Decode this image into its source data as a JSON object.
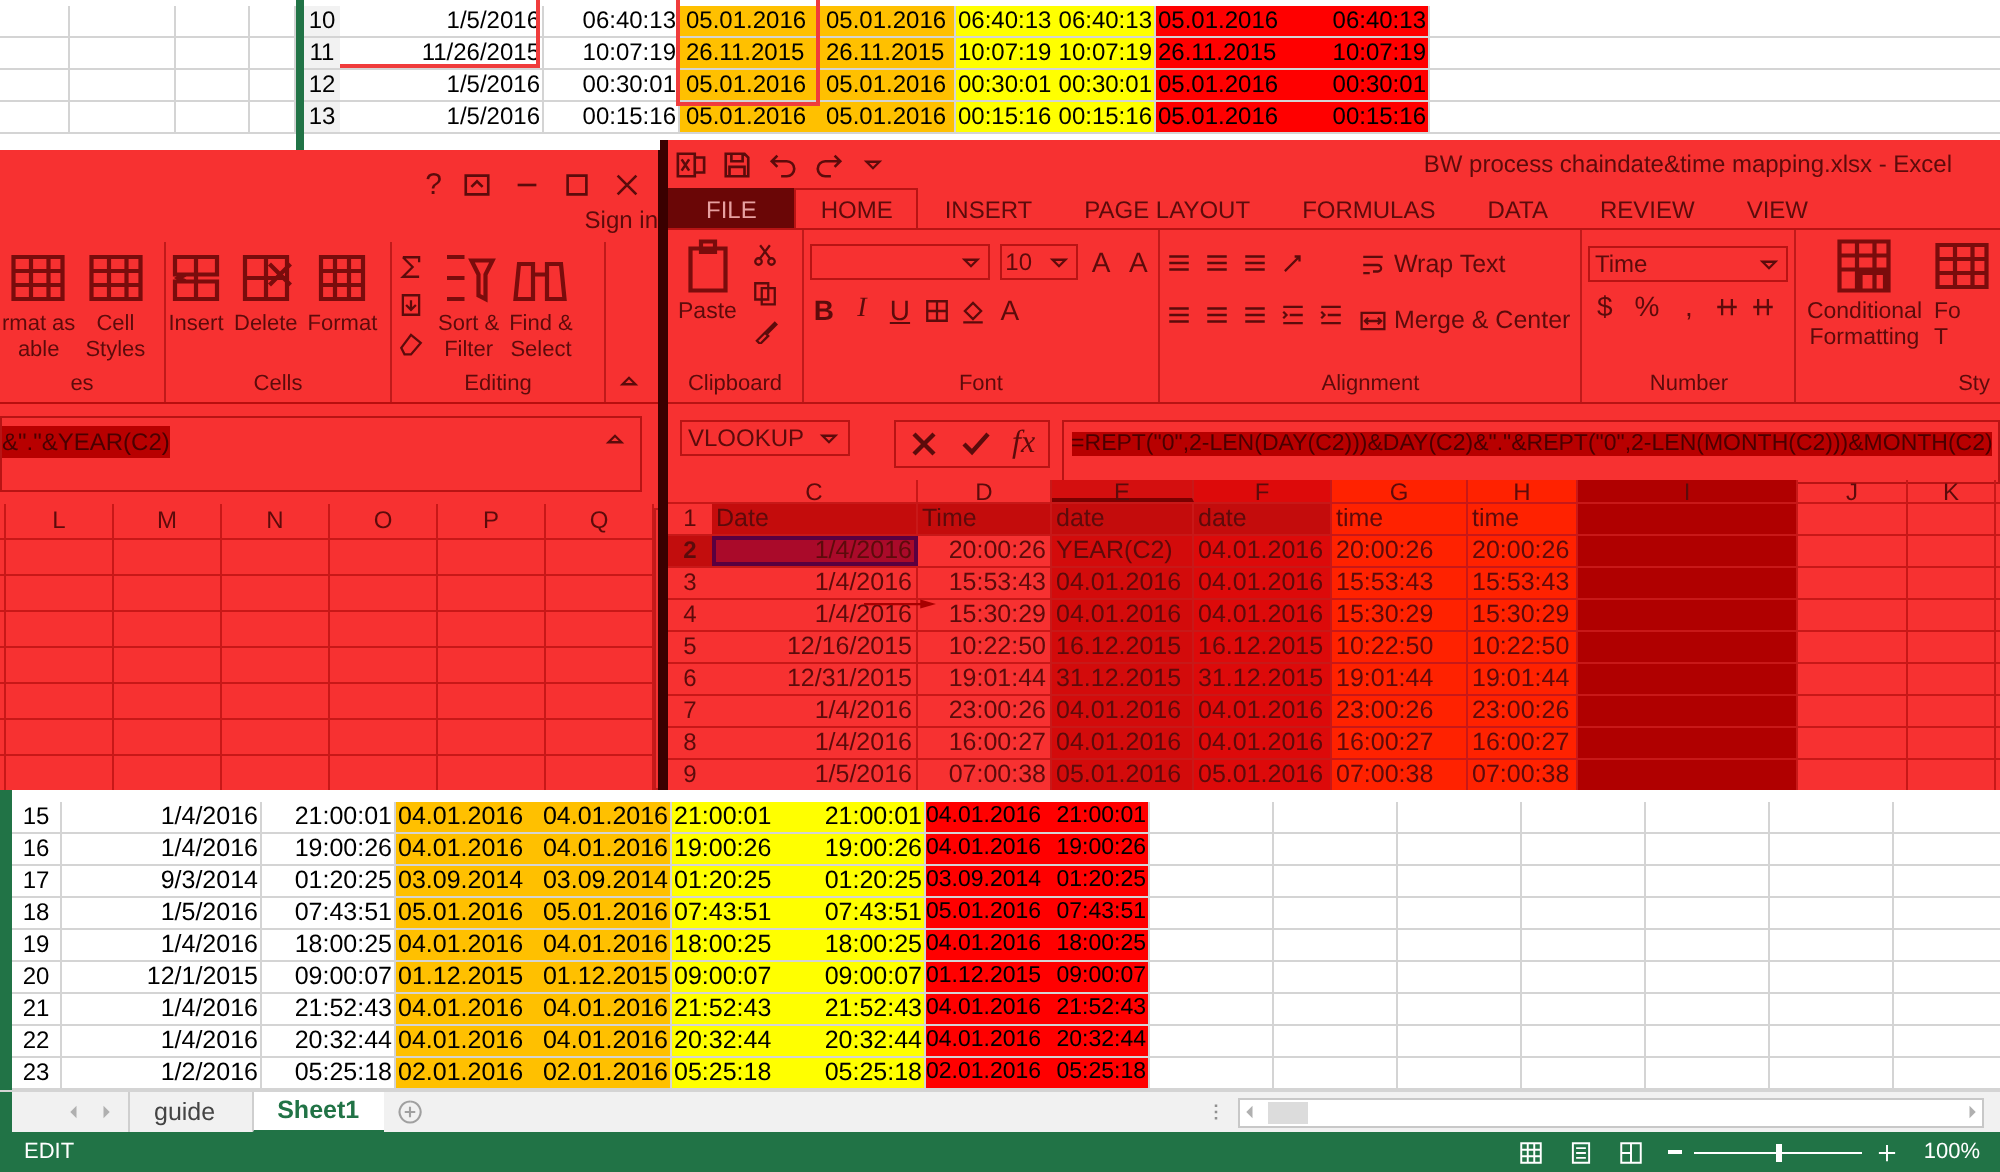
{
  "top_sheet": {
    "rows": [
      {
        "header": "10",
        "cells": [
          "1/5/2016",
          "06:40:13",
          "05.01.2016",
          "05.01.2016",
          "06:40:13",
          "06:40:13",
          "05.01.2016",
          "06:40:13"
        ]
      },
      {
        "header": "11",
        "cells": [
          "11/26/2015",
          "10:07:19",
          "26.11.2015",
          "26.11.2015",
          "10:07:19",
          "10:07:19",
          "26.11.2015",
          "10:07:19"
        ]
      },
      {
        "header": "12",
        "cells": [
          "1/5/2016",
          "00:30:01",
          "05.01.2016",
          "05.01.2016",
          "00:30:01",
          "00:30:01",
          "05.01.2016",
          "00:30:01"
        ]
      },
      {
        "header": "13",
        "cells": [
          "1/5/2016",
          "00:15:16",
          "05.01.2016",
          "05.01.2016",
          "00:15:16",
          "00:15:16",
          "05.01.2016",
          "00:15:16"
        ]
      }
    ]
  },
  "left_window": {
    "help": "?",
    "sign_in": "Sign in",
    "groups": [
      {
        "label": "es",
        "kind": "styles"
      },
      {
        "label": "Cells",
        "kind": "cells"
      },
      {
        "label": "Editing",
        "kind": "editing"
      }
    ],
    "buttons": [
      {
        "kind": "table",
        "lines": [
          "rmat as",
          "able"
        ]
      },
      {
        "kind": "styles",
        "lines": [
          "Cell",
          "Styles"
        ]
      },
      {
        "kind": "insert",
        "lines": [
          "Insert"
        ]
      },
      {
        "kind": "delete",
        "lines": [
          "Delete"
        ]
      },
      {
        "kind": "format",
        "lines": [
          "Format"
        ]
      },
      {
        "kind": "sort",
        "lines": [
          "Sort &",
          "Filter"
        ]
      },
      {
        "kind": "find",
        "lines": [
          "Find &",
          "Select"
        ]
      }
    ],
    "formula_fragment": "&\".\"&YEAR(C2)",
    "columns": [
      "L",
      "M",
      "N",
      "O",
      "P",
      "Q"
    ]
  },
  "main_window": {
    "title": "BW process chaindate&time mapping.xlsx - Excel",
    "tabs": [
      {
        "label": "FILE",
        "kind": "file",
        "selected": false
      },
      {
        "label": "HOME",
        "kind": "tab",
        "selected": true
      },
      {
        "label": "INSERT",
        "kind": "tab",
        "selected": false
      },
      {
        "label": "PAGE LAYOUT",
        "kind": "tab",
        "selected": false
      },
      {
        "label": "FORMULAS",
        "kind": "tab",
        "selected": false
      },
      {
        "label": "DATA",
        "kind": "tab",
        "selected": false
      },
      {
        "label": "REVIEW",
        "kind": "tab",
        "selected": false
      },
      {
        "label": "VIEW",
        "kind": "tab",
        "selected": false
      }
    ],
    "clipboard": {
      "label": "Clipboard",
      "paste": "Paste"
    },
    "font": {
      "label": "Font",
      "size": "10",
      "size_buttons": [
        "A",
        "A"
      ],
      "format_buttons": [
        "B",
        "I",
        "U"
      ],
      "font_color": "A"
    },
    "alignment": {
      "label": "Alignment",
      "wrap": "Wrap Text",
      "merge": "Merge & Center"
    },
    "number": {
      "label": "Number",
      "format": "Time",
      "symbols": [
        "$",
        "%",
        ","
      ]
    },
    "styles": {
      "label": "Sty",
      "conditional": [
        "Conditional",
        "Formatting"
      ],
      "cut_lines": [
        "Fo",
        "T"
      ]
    },
    "name_box": "VLOOKUP",
    "fx": "fx",
    "formula": "=REPT(\"0\",2-LEN(DAY(C2)))&DAY(C2)&\".\"&REPT(\"0\",2-LEN(MONTH(C2)))&MONTH(C2)",
    "columns": [
      {
        "label": "C",
        "selected": false
      },
      {
        "label": "D",
        "selected": false
      },
      {
        "label": "E",
        "selected": true
      },
      {
        "label": "F",
        "selected": false
      },
      {
        "label": "G",
        "selected": false
      },
      {
        "label": "H",
        "selected": false
      },
      {
        "label": "I",
        "selected": false
      },
      {
        "label": "J",
        "selected": false
      },
      {
        "label": "K",
        "selected": false
      }
    ],
    "rows": [
      {
        "header": "1",
        "selected": false,
        "cells": [
          "Date",
          "Time",
          "date",
          "date",
          "time",
          "time"
        ]
      },
      {
        "header": "2",
        "selected": true,
        "cells": [
          "1/4/2016",
          "20:00:26",
          "YEAR(C2)",
          "04.01.2016",
          "20:00:26",
          "20:00:26"
        ]
      },
      {
        "header": "3",
        "selected": false,
        "cells": [
          "1/4/2016",
          "15:53:43",
          "04.01.2016",
          "04.01.2016",
          "15:53:43",
          "15:53:43"
        ]
      },
      {
        "header": "4",
        "selected": false,
        "cells": [
          "1/4/2016",
          "15:30:29",
          "04.01.2016",
          "04.01.2016",
          "15:30:29",
          "15:30:29"
        ]
      },
      {
        "header": "5",
        "selected": false,
        "cells": [
          "12/16/2015",
          "10:22:50",
          "16.12.2015",
          "16.12.2015",
          "10:22:50",
          "10:22:50"
        ]
      },
      {
        "header": "6",
        "selected": false,
        "cells": [
          "12/31/2015",
          "19:01:44",
          "31.12.2015",
          "31.12.2015",
          "19:01:44",
          "19:01:44"
        ]
      },
      {
        "header": "7",
        "selected": false,
        "cells": [
          "1/4/2016",
          "23:00:26",
          "04.01.2016",
          "04.01.2016",
          "23:00:26",
          "23:00:26"
        ]
      },
      {
        "header": "8",
        "selected": false,
        "cells": [
          "1/4/2016",
          "16:00:27",
          "04.01.2016",
          "04.01.2016",
          "16:00:27",
          "16:00:27"
        ]
      },
      {
        "header": "9",
        "selected": false,
        "cells": [
          "1/5/2016",
          "07:00:38",
          "05.01.2016",
          "05.01.2016",
          "07:00:38",
          "07:00:38"
        ]
      }
    ]
  },
  "bottom_sheet": {
    "rows": [
      {
        "header": "15",
        "cells": [
          "1/4/2016",
          "21:00:01",
          "04.01.2016",
          "04.01.2016",
          "21:00:01",
          "21:00:01",
          "04.01.2016",
          "21:00:01"
        ]
      },
      {
        "header": "16",
        "cells": [
          "1/4/2016",
          "19:00:26",
          "04.01.2016",
          "04.01.2016",
          "19:00:26",
          "19:00:26",
          "04.01.2016",
          "19:00:26"
        ]
      },
      {
        "header": "17",
        "cells": [
          "9/3/2014",
          "01:20:25",
          "03.09.2014",
          "03.09.2014",
          "01:20:25",
          "01:20:25",
          "03.09.2014",
          "01:20:25"
        ]
      },
      {
        "header": "18",
        "cells": [
          "1/5/2016",
          "07:43:51",
          "05.01.2016",
          "05.01.2016",
          "07:43:51",
          "07:43:51",
          "05.01.2016",
          "07:43:51"
        ]
      },
      {
        "header": "19",
        "cells": [
          "1/4/2016",
          "18:00:25",
          "04.01.2016",
          "04.01.2016",
          "18:00:25",
          "18:00:25",
          "04.01.2016",
          "18:00:25"
        ]
      },
      {
        "header": "20",
        "cells": [
          "12/1/2015",
          "09:00:07",
          "01.12.2015",
          "01.12.2015",
          "09:00:07",
          "09:00:07",
          "01.12.2015",
          "09:00:07"
        ]
      },
      {
        "header": "21",
        "cells": [
          "1/4/2016",
          "21:52:43",
          "04.01.2016",
          "04.01.2016",
          "21:52:43",
          "21:52:43",
          "04.01.2016",
          "21:52:43"
        ]
      },
      {
        "header": "22",
        "cells": [
          "1/4/2016",
          "20:32:44",
          "04.01.2016",
          "04.01.2016",
          "20:32:44",
          "20:32:44",
          "04.01.2016",
          "20:32:44"
        ]
      },
      {
        "header": "23",
        "cells": [
          "1/2/2016",
          "05:25:18",
          "02.01.2016",
          "02.01.2016",
          "05:25:18",
          "05:25:18",
          "02.01.2016",
          "05:25:18"
        ]
      }
    ]
  },
  "sheet_tabs": [
    {
      "label": "guide",
      "selected": false
    },
    {
      "label": "Sheet1",
      "selected": true
    }
  ],
  "status_bar": {
    "mode": "EDIT",
    "zoom": "100%",
    "level": 0.5
  }
}
